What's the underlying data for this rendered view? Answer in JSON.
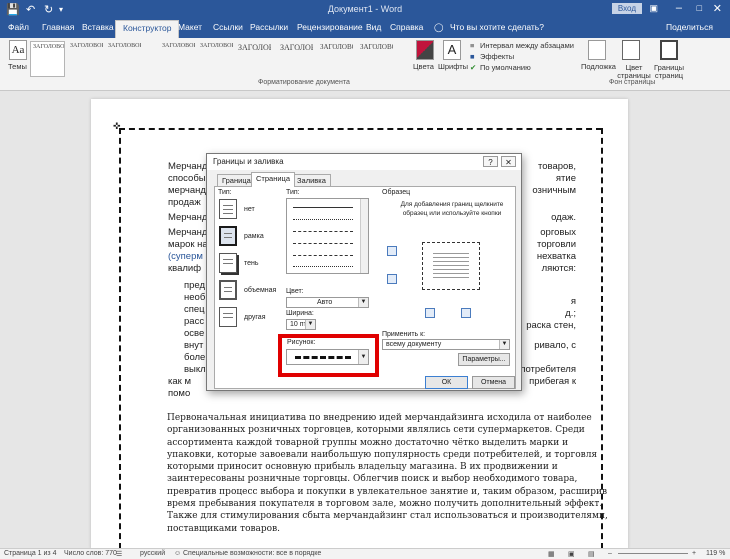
{
  "window": {
    "doc_title": "Документ1 - Word",
    "login": "Вход"
  },
  "tabs": {
    "file": "Файл",
    "home": "Главная",
    "insert": "Вставка",
    "design": "Конструктор",
    "layout": "Макет",
    "refs": "Ссылки",
    "mailings": "Рассылки",
    "review": "Рецензирование",
    "view": "Вид",
    "help": "Справка",
    "tell": "Что вы хотите сделать?",
    "share": "Поделиться"
  },
  "ribbon": {
    "themes": "Темы",
    "style_sample": "ЗАГОЛОВОК",
    "colors": "Цвета",
    "fonts": "Шрифты",
    "para_spacing": "Интервал между абзацами",
    "effects": "Эффекты",
    "default": "По умолчанию",
    "watermark": "Подложка",
    "page_color": "Цвет страницы",
    "page_borders": "Границы страниц",
    "group_doc_format": "Форматирование документа",
    "group_page_bg": "Фон страницы"
  },
  "page": {
    "left_lines": [
      "Мерчанд",
      "способы",
      "мерчанд",
      "продаж",
      "Мерчанд",
      "Мерчанд",
      "марок на",
      "(суперм",
      "квалиф",
      "пред",
      "необ",
      "спец",
      "расс",
      "осве",
      "внут",
      "боле",
      "выкл",
      "как м",
      "помо"
    ],
    "right_lines": [
      "товаров,",
      "ятие",
      "озничным",
      "одаж.",
      "орговых",
      "торговли",
      "нехватка",
      "ляются:",
      "я",
      "д.;",
      "раска стен,",
      "ривало, с",
      "потребителя",
      "прибегая к"
    ],
    "body": [
      "Первоначальная инициатива по внедрению идей мерчандайзинга исходила от наиболее",
      "организованных розничных торговцев, которыми являлись сети супермаркетов. Среди",
      "ассортимента каждой товарной группы можно достаточно чётко выделить марки и",
      "упаковки, которые завоевали наибольшую популярность среди потребителей, и торговля",
      "которыми приносит основную прибыль владельцу магазина. В их продвижении и",
      "заинтересованы розничные торговцы. Облегчив поиск и выбор необходимого товара,",
      "превратив процесс выбора и покупки в увлекательное занятие и, таким образом, расширив",
      "время пребывания покупателя в торговом зале, можно получить дополнительный эффект.",
      "Также для стимулирования сбыта мерчандайзинг стал использоваться и производителями,",
      "поставщиками товаров."
    ]
  },
  "dialog": {
    "title": "Границы и заливка",
    "tabs": [
      "Граница",
      "Страница",
      "Заливка"
    ],
    "type_label": "Тип:",
    "settings": [
      "нет",
      "рамка",
      "тень",
      "объемная",
      "другая"
    ],
    "style_label": "Тип:",
    "color_label": "Цвет:",
    "color_value": "Авто",
    "width_label": "Ширина:",
    "width_value": "10 пт",
    "art_label": "Рисунок:",
    "preview_label": "Образец",
    "preview_hint": "Для добавления границ щелкните образец или используйте кнопки",
    "apply_label": "Применить к:",
    "apply_value": "всему документу",
    "options_button": "Параметры...",
    "ok": "ОК",
    "cancel": "Отмена"
  },
  "status": {
    "page": "Страница 1 из 4",
    "words": "Число слов: 770",
    "lang": "русский",
    "access": "Специальные возможности: все в порядке",
    "zoom": "119 %"
  }
}
